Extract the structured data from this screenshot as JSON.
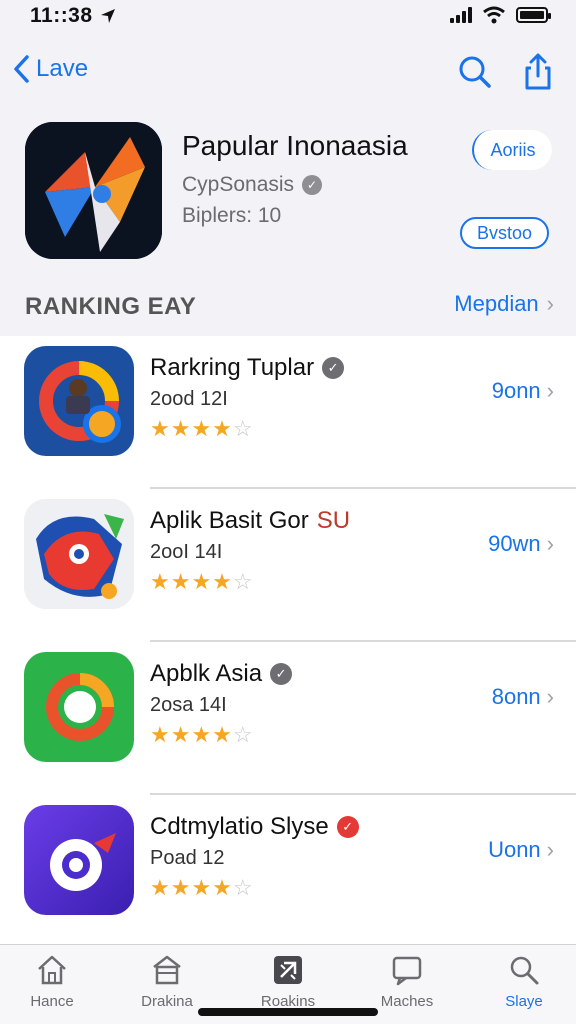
{
  "status": {
    "time": "11::38"
  },
  "nav": {
    "back_label": "Lave"
  },
  "hero": {
    "title": "Papular Inonaasia",
    "subtitle": "CypSonasis",
    "meta": "Biplers: 10",
    "pill_top": "Aoriis",
    "pill_bottom": "Bvstoo"
  },
  "section": {
    "title": "RANKING EAY",
    "link": "Mepdian"
  },
  "apps": [
    {
      "name": "Rarkring Tuplar",
      "sub": "2ood 12I",
      "rating": 4,
      "action": "9onn",
      "badge": "gray"
    },
    {
      "name": "Aplik Basit Gor",
      "name_suffix": "SU",
      "sub": "2ooI 14I",
      "rating": 4,
      "action": "90wn",
      "badge": "none"
    },
    {
      "name": "Apblk Asia",
      "sub": "2osa 14I",
      "rating": 4,
      "action": "8onn",
      "badge": "gray"
    },
    {
      "name": "Cdtmylatio Slyse",
      "sub": "Poad 12",
      "rating": 4,
      "action": "Uonn",
      "badge": "red"
    }
  ],
  "tabs": [
    {
      "label": "Hance",
      "icon": "home-icon"
    },
    {
      "label": "Drakina",
      "icon": "store-icon"
    },
    {
      "label": "Roakins",
      "icon": "ranking-icon"
    },
    {
      "label": "Maches",
      "icon": "message-icon"
    },
    {
      "label": "Slaye",
      "icon": "search-icon"
    }
  ],
  "colors": {
    "accent": "#1a73e8",
    "star": "#f5a623",
    "verified_gray": "#8e8e93",
    "verified_red": "#e53935"
  }
}
